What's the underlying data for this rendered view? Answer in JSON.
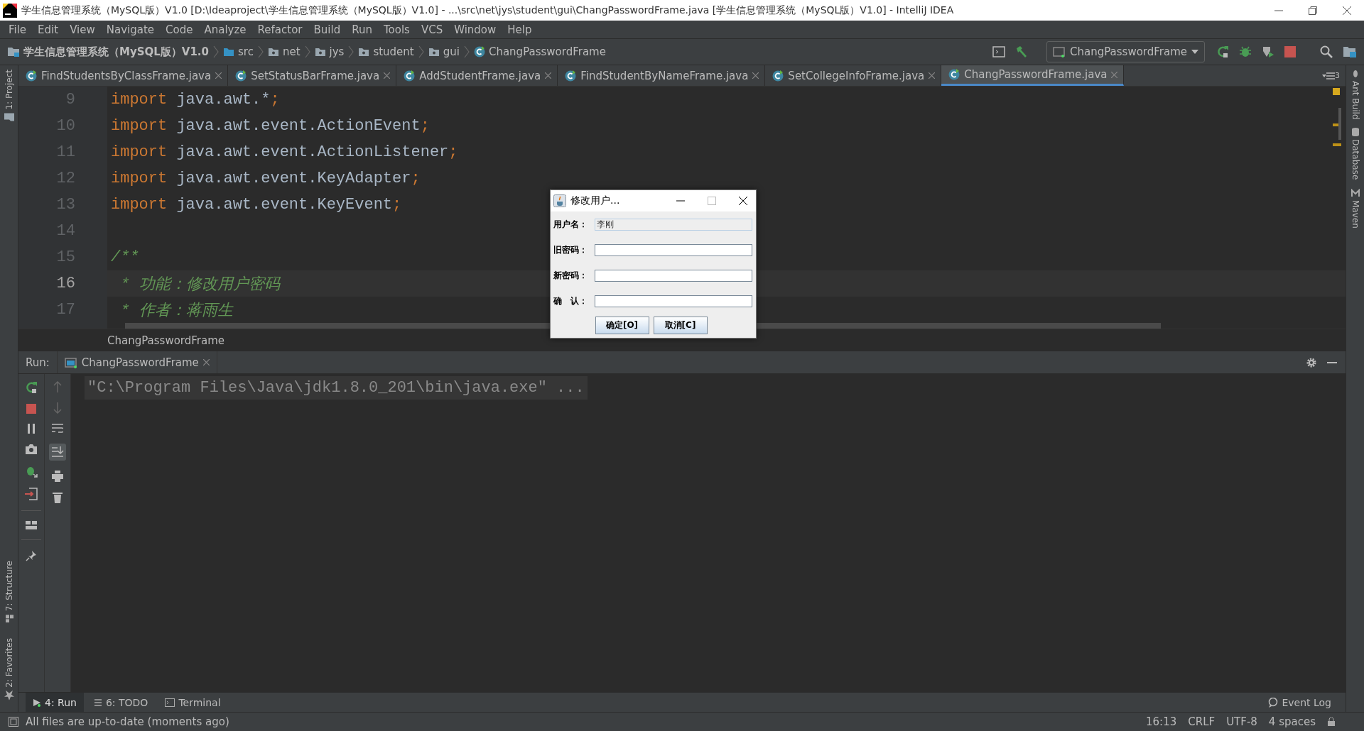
{
  "window": {
    "title": "学生信息管理系统（MySQL版）V1.0 [D:\\Ideaproject\\学生信息管理系统（MySQL版）V1.0] - ...\\src\\net\\jys\\student\\gui\\ChangPasswordFrame.java [学生信息管理系统（MySQL版）V1.0] - IntelliJ IDEA"
  },
  "menu": [
    "File",
    "Edit",
    "View",
    "Navigate",
    "Code",
    "Analyze",
    "Refactor",
    "Build",
    "Run",
    "Tools",
    "VCS",
    "Window",
    "Help"
  ],
  "breadcrumb": [
    {
      "label": "学生信息管理系统（MySQL版）V1.0",
      "kind": "project"
    },
    {
      "label": "src",
      "kind": "source"
    },
    {
      "label": "net",
      "kind": "package"
    },
    {
      "label": "jys",
      "kind": "package"
    },
    {
      "label": "student",
      "kind": "package"
    },
    {
      "label": "gui",
      "kind": "package"
    },
    {
      "label": "ChangPasswordFrame",
      "kind": "class"
    }
  ],
  "run_config": "ChangPasswordFrame",
  "tabs": [
    {
      "label": "FindStudentsByClassFrame.java",
      "selected": false
    },
    {
      "label": "SetStatusBarFrame.java",
      "selected": false
    },
    {
      "label": "AddStudentFrame.java",
      "selected": false
    },
    {
      "label": "FindStudentByNameFrame.java",
      "selected": false
    },
    {
      "label": "SetCollegeInfoFrame.java",
      "selected": false
    },
    {
      "label": "ChangPasswordFrame.java",
      "selected": true
    }
  ],
  "tab_overflow": "3",
  "left_stripe": [
    "1: Project",
    "7: Structure",
    "2: Favorites"
  ],
  "right_stripe": [
    "Ant Build",
    "Database",
    "Maven"
  ],
  "editor": {
    "lines": [
      {
        "number": "9",
        "current": false,
        "segments": [
          {
            "kind": "keyword",
            "text": "import"
          },
          {
            "kind": "plain",
            "text": " java.awt.*"
          },
          {
            "kind": "keyword",
            "text": ";"
          }
        ]
      },
      {
        "number": "10",
        "current": false,
        "segments": [
          {
            "kind": "keyword",
            "text": "import"
          },
          {
            "kind": "plain",
            "text": " java.awt.event.ActionEvent"
          },
          {
            "kind": "keyword",
            "text": ";"
          }
        ]
      },
      {
        "number": "11",
        "current": false,
        "segments": [
          {
            "kind": "keyword",
            "text": "import"
          },
          {
            "kind": "plain",
            "text": " java.awt.event.ActionListener"
          },
          {
            "kind": "keyword",
            "text": ";"
          }
        ]
      },
      {
        "number": "12",
        "current": false,
        "segments": [
          {
            "kind": "keyword",
            "text": "import"
          },
          {
            "kind": "plain",
            "text": " java.awt.event.KeyAdapter"
          },
          {
            "kind": "keyword",
            "text": ";"
          }
        ]
      },
      {
        "number": "13",
        "current": false,
        "segments": [
          {
            "kind": "keyword",
            "text": "import"
          },
          {
            "kind": "plain",
            "text": " java.awt.event.KeyEvent"
          },
          {
            "kind": "keyword",
            "text": ";"
          }
        ]
      },
      {
        "number": "14",
        "current": false
      },
      {
        "number": "15",
        "current": false,
        "segments": [
          {
            "kind": "comment",
            "text": "/**"
          }
        ]
      },
      {
        "number": "16",
        "current": true,
        "segments": [
          {
            "kind": "comment",
            "text": " * 功能：修改用户密码"
          }
        ]
      },
      {
        "number": "17",
        "current": false,
        "segments": [
          {
            "kind": "comment",
            "text": " * 作者：蒋雨生"
          }
        ]
      }
    ]
  },
  "editor_footer": "ChangPasswordFrame",
  "run": {
    "label": "Run:",
    "tab": "ChangPasswordFrame",
    "console": "\"C:\\Program Files\\Java\\jdk1.8.0_201\\bin\\java.exe\" ..."
  },
  "dialog": {
    "title": "修改用户...",
    "fields": [
      {
        "label": "用户名：",
        "value": "李刚",
        "disabled": true
      },
      {
        "label": "旧密码：",
        "disabled": false
      },
      {
        "label": "新密码：",
        "disabled": false
      },
      {
        "label": "确　认：",
        "disabled": false
      }
    ],
    "buttons": [
      "确定[O]",
      "取消[C]"
    ]
  },
  "bottom_tools": [
    {
      "label": "4: Run",
      "kind": "run",
      "selected": true
    },
    {
      "label": "6: TODO",
      "kind": "todo",
      "selected": false
    },
    {
      "label": "Terminal",
      "kind": "terminal",
      "selected": false
    }
  ],
  "event_log": "Event Log",
  "status": {
    "message": "All files are up-to-date (moments ago)",
    "position": "16:13",
    "line_separator": "CRLF",
    "encoding": "UTF-8",
    "indent": "4 spaces"
  }
}
